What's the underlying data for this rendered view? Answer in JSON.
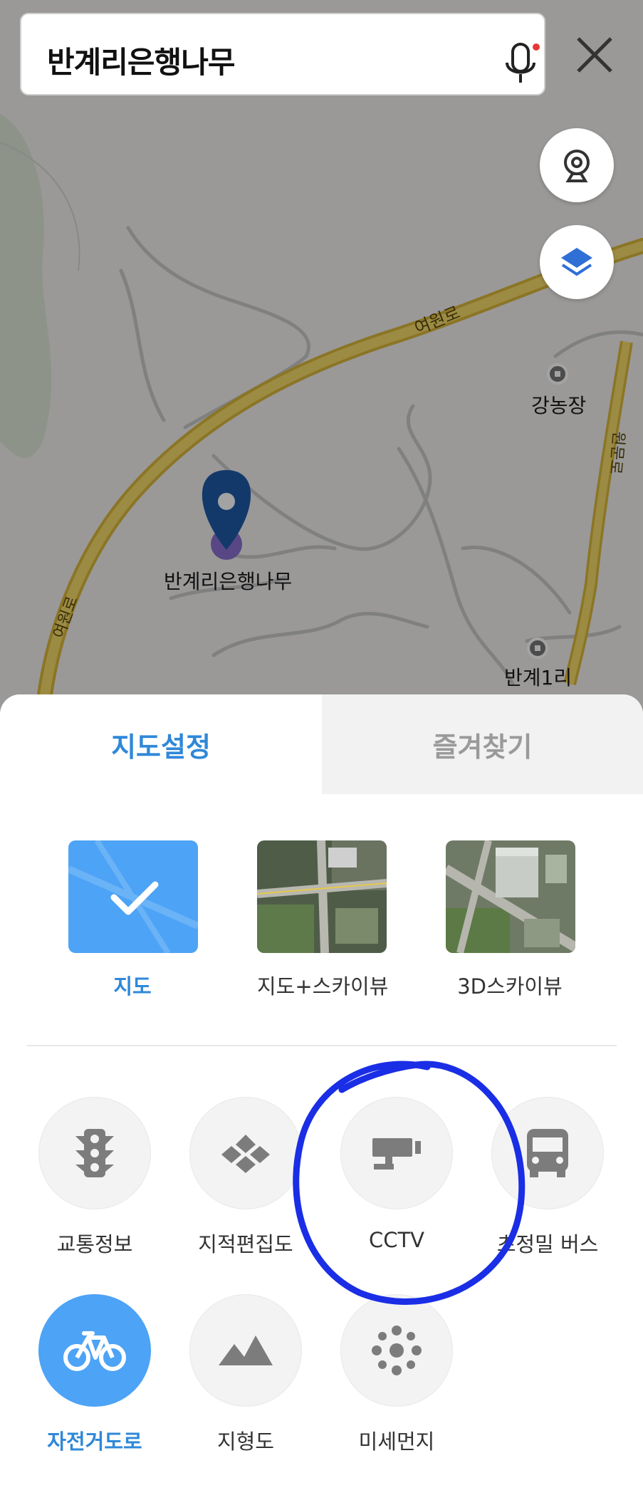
{
  "search": {
    "query": "반계리은행나무"
  },
  "map": {
    "road_label_top": "여원로",
    "road_label_left": "여원로",
    "road_label_right": "원문로",
    "place_marker_label": "반계리은행나무",
    "poi_1": "강농장",
    "poi_2": "반계1리"
  },
  "sheet": {
    "tabs": [
      {
        "label": "지도설정",
        "active": true
      },
      {
        "label": "즐겨찾기",
        "active": false
      }
    ],
    "map_types": [
      {
        "label": "지도",
        "selected": true
      },
      {
        "label": "지도+스카이뷰",
        "selected": false
      },
      {
        "label": "3D스카이뷰",
        "selected": false
      }
    ],
    "layers": [
      {
        "label": "교통정보",
        "icon": "traffic-light-icon",
        "on": false
      },
      {
        "label": "지적편집도",
        "icon": "cadastral-icon",
        "on": false
      },
      {
        "label": "CCTV",
        "icon": "cctv-camera-icon",
        "on": false
      },
      {
        "label": "초정밀 버스",
        "icon": "bus-icon",
        "on": false
      },
      {
        "label": "자전거도로",
        "icon": "bicycle-icon",
        "on": true
      },
      {
        "label": "지형도",
        "icon": "mountain-icon",
        "on": false
      },
      {
        "label": "미세먼지",
        "icon": "fine-dust-icon",
        "on": false
      }
    ]
  },
  "colors": {
    "accent": "#2f88d8",
    "toggle_on": "#4da3f5",
    "road": "#e6c84a",
    "annotation": "#1a2ee6",
    "marker": "#1f5aa8"
  }
}
